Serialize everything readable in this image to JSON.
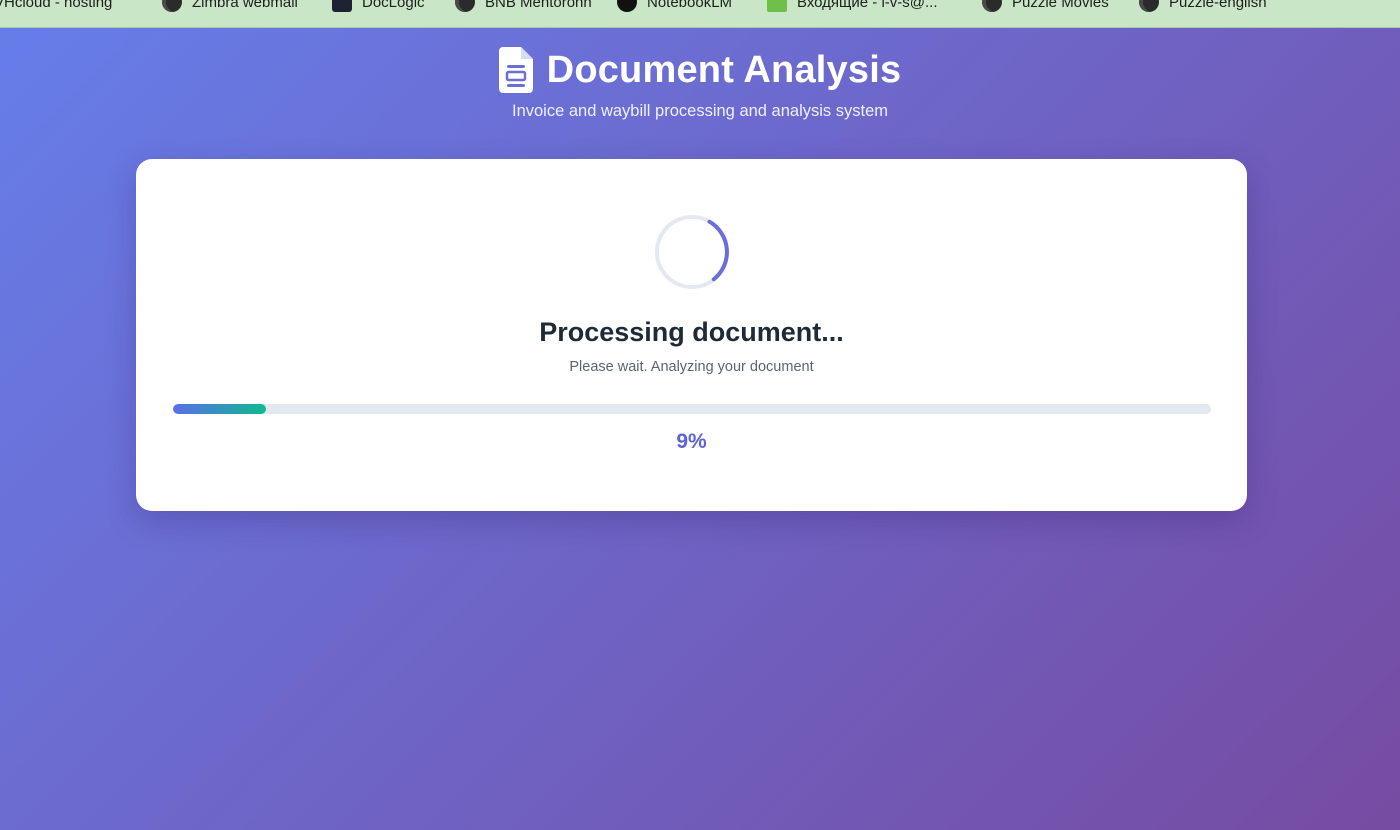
{
  "bookmarks": [
    {
      "label": "VHcloud - hosting",
      "icon": "globe-icon"
    },
    {
      "label": "Zimbra webmail",
      "icon": "globe-icon"
    },
    {
      "label": "DocLogic",
      "icon": "doclogic-icon"
    },
    {
      "label": "BNB Mentoronn",
      "icon": "globe-icon"
    },
    {
      "label": "NotebookLM",
      "icon": "ai-icon"
    },
    {
      "label": "Входящие - i-v-s@...",
      "icon": "mail-icon"
    },
    {
      "label": "Puzzle Movies",
      "icon": "globe-icon"
    },
    {
      "label": "Puzzle-english",
      "icon": "globe-icon"
    }
  ],
  "header": {
    "title": "Document Analysis",
    "subtitle": "Invoice and waybill processing and analysis system",
    "icon": "document-icon"
  },
  "processing": {
    "title": "Processing document...",
    "message": "Please wait. Analyzing your document",
    "progress_percent": 9,
    "progress_label": "9%"
  },
  "colors": {
    "background_start": "#667eea",
    "background_end": "#764ba2",
    "accent": "#5b63d6",
    "progress_start": "#5b6ee8",
    "progress_end": "#10b98f",
    "bookmarks_bar": "#c9e6c6"
  }
}
